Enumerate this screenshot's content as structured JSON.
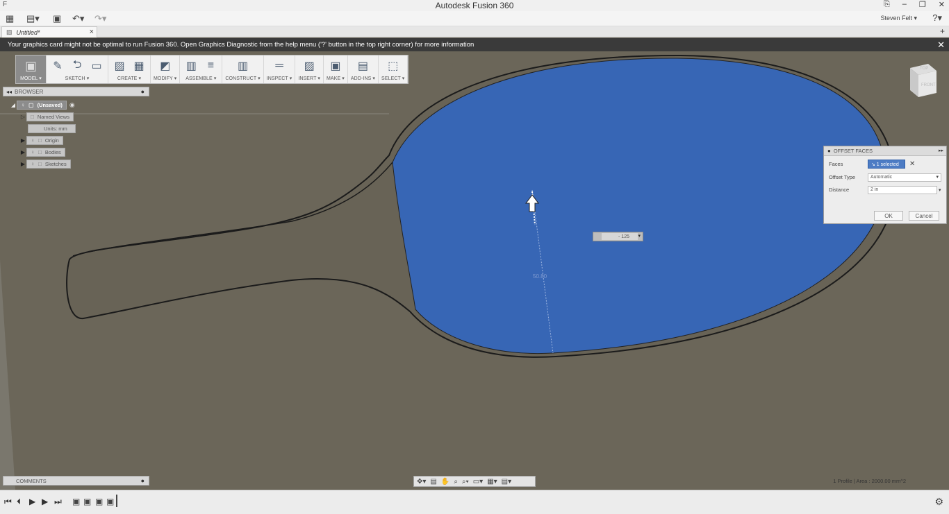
{
  "window": {
    "title": "Autodesk Fusion 360",
    "app_glyph": "F",
    "controls": [
      "⎘",
      "–",
      "❐",
      "✕"
    ]
  },
  "qat": {
    "grid": "▦",
    "file": "▤▾",
    "save": "▣",
    "undo": "↶▾",
    "redo": "↷▾",
    "user": "Steven Felt ▾",
    "help": "?▾"
  },
  "tab": {
    "icon": "▧",
    "label": "Untitled*",
    "close": "×",
    "plus": "+"
  },
  "banner": {
    "message": "Your graphics card might not be optimal to run Fusion 360. Open Graphics Diagnostic from the help menu ('?' button in the top right corner) for more information",
    "close": "✕"
  },
  "ribbon": {
    "groups": [
      {
        "label": "MODEL ▾",
        "icons": [
          "▣"
        ]
      },
      {
        "label": "SKETCH ▾",
        "icons": [
          "✎",
          "⮌",
          "▭"
        ]
      },
      {
        "label": "CREATE ▾",
        "icons": [
          "▨",
          "▦"
        ]
      },
      {
        "label": "MODIFY ▾",
        "icons": [
          "◩"
        ]
      },
      {
        "label": "ASSEMBLE ▾",
        "icons": [
          "▥",
          "≡"
        ]
      },
      {
        "label": "CONSTRUCT ▾",
        "icons": [
          "▥"
        ]
      },
      {
        "label": "INSPECT ▾",
        "icons": [
          "═"
        ]
      },
      {
        "label": "INSERT ▾",
        "icons": [
          "▨"
        ]
      },
      {
        "label": "MAKE ▾",
        "icons": [
          "▣"
        ]
      },
      {
        "label": "ADD-INS ▾",
        "icons": [
          "▤"
        ]
      },
      {
        "label": "SELECT ▾",
        "icons": [
          "⬚"
        ]
      }
    ]
  },
  "browser": {
    "title": "BROWSER",
    "collapse": "◂◂",
    "pin": "●",
    "root": "(Unsaved)",
    "items": [
      {
        "label": "Named Views",
        "icon": "□"
      },
      {
        "label": "Units: mm",
        "icon": ""
      },
      {
        "label": "Origin",
        "icon": "□"
      },
      {
        "label": "Bodies",
        "icon": "□"
      },
      {
        "label": "Sketches",
        "icon": "□"
      }
    ]
  },
  "dialog": {
    "title": "OFFSET FACES",
    "faces_label": "Faces",
    "faces_value": "↘ 1 selected",
    "offset_type_label": "Offset Type",
    "offset_type_value": "Automatic",
    "distance_label": "Distance",
    "distance_value": "2 in",
    "ok": "OK",
    "cancel": "Cancel"
  },
  "viewport": {
    "value_input": "- 125",
    "dimension": "50.80",
    "status": "1 Profile | Area : 2000.00 mm^2",
    "face_color": "#3766b5",
    "background_color": "#6b6659"
  },
  "viewcube": {
    "top": "TOP",
    "front": "FRONT"
  },
  "comments": {
    "title": "COMMENTS",
    "plus": "●"
  },
  "navbar": {
    "icons": [
      "✥▾",
      "▤",
      "✋",
      "⌕",
      "⌕▾",
      "▭▾",
      "▦▾",
      "▤▾"
    ]
  },
  "timeline": {
    "controls": [
      "⏮",
      "⏴",
      "▶",
      "▶",
      "⏭"
    ],
    "features": [
      "▣",
      "▣",
      "▣",
      "▣"
    ],
    "settings": "⚙"
  }
}
